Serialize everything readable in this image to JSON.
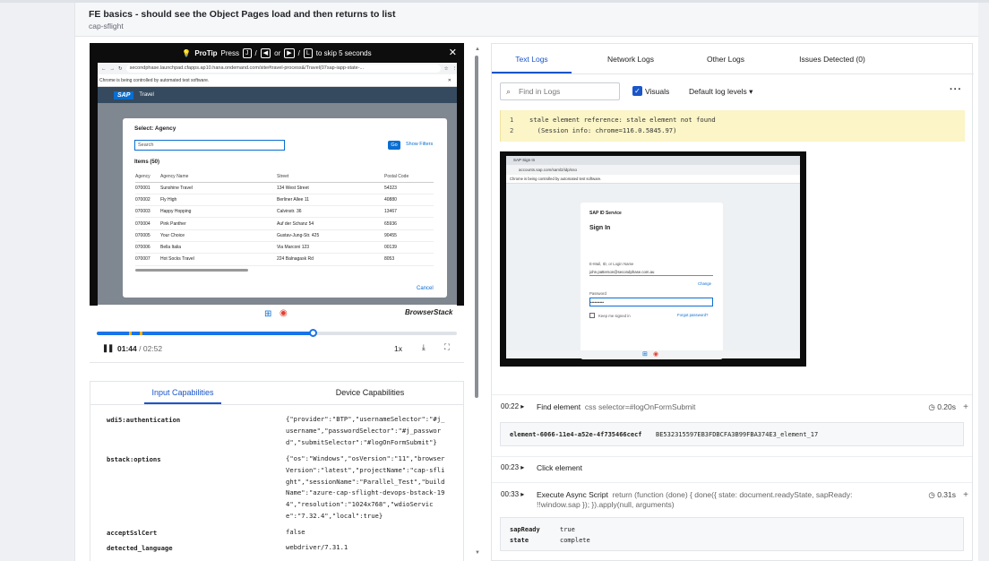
{
  "header": {
    "title": "FE basics - should see the Object Pages load and then returns to list",
    "subtitle": "cap-sflight"
  },
  "video": {
    "protip_label": "ProTip",
    "protip_press": "Press",
    "protip_keys": [
      "J",
      "K",
      "L"
    ],
    "protip_or": "or",
    "protip_slash": "/",
    "protip_suffix": "to skip 5 seconds",
    "browser_url": "secondphase.launchpad.cfapps.ap10.hana.ondemand.com/site#travel-process&/Travel(07sap-iapp-state-...",
    "automation_banner": "Chrome is being controlled by automated test software.",
    "sap_logo": "SAP",
    "app_title": "Travel",
    "dialog_title": "Select: Agency",
    "search_placeholder": "Search",
    "go_label": "Go",
    "show_filters": "Show Filters",
    "items_label": "Items (50)",
    "columns": [
      "Agency",
      "Agency Name",
      "Street",
      "Postal Code"
    ],
    "rows": [
      [
        "070001",
        "Sunshine Travel",
        "134 West Street",
        "54323"
      ],
      [
        "070002",
        "Fly High",
        "Berliner Allee 11",
        "40880"
      ],
      [
        "070003",
        "Happy Hopping",
        "Calvinstr. 36",
        "13467"
      ],
      [
        "070004",
        "Pink Panther",
        "Auf der Schanz 54",
        "65936"
      ],
      [
        "070005",
        "Your Choice",
        "Gustav-Jung-Str. 425",
        "90455"
      ],
      [
        "070006",
        "Bella Italia",
        "Via Marconi 123",
        "00139"
      ],
      [
        "070007",
        "Hot Socks Travel",
        "224 Balnagask Rd",
        "8053"
      ]
    ],
    "cancel_label": "Cancel",
    "brand": "BrowserStack",
    "current_time": "01:44",
    "duration": "02:52",
    "speed": "1x",
    "progress_fraction": 0.6,
    "marker_fractions": [
      0.09,
      0.12
    ]
  },
  "capabilities": {
    "tabs": [
      "Input Capabilities",
      "Device Capabilities"
    ],
    "rows": [
      {
        "key": "wdi5:authentication",
        "value": "{\"provider\":\"BTP\",\"usernameSelector\":\"#j_username\",\"passwordSelector\":\"#j_password\",\"submitSelector\":\"#logOnFormSubmit\"}"
      },
      {
        "key": "bstack:options",
        "value": "{\"os\":\"Windows\",\"osVersion\":\"11\",\"browserVersion\":\"latest\",\"projectName\":\"cap-sflight\",\"sessionName\":\"Parallel_Test\",\"buildName\":\"azure-cap-sflight-devops-bstack-194\",\"resolution\":\"1024x768\",\"wdioService\":\"7.32.4\",\"local\":true}"
      },
      {
        "key": "acceptSslCert",
        "value": "false"
      },
      {
        "key": "detected_language",
        "value": "webdriver/7.31.1"
      }
    ]
  },
  "logs": {
    "tabs": [
      "Text Logs",
      "Network Logs",
      "Other Logs",
      "Issues Detected (0)"
    ],
    "find_placeholder": "Find in Logs",
    "visuals_label": "Visuals",
    "levels_label": "Default log levels",
    "error_lines": [
      {
        "n": "1",
        "text": "stale element reference: stale element not found"
      },
      {
        "n": "2",
        "text": "  (Session info: chrome=116.0.5845.97)"
      }
    ],
    "screenshot": {
      "tab_label": "SAP Sign In",
      "url": "accounts.sap.com/saml2/idp/sso",
      "automation_banner": "Chrome is being controlled by automated test software.",
      "service": "SAP ID Service",
      "heading": "Sign In",
      "email_label": "E-Mail, ID, or Login Name",
      "email_value": "john.patterson@secondphase.com.au",
      "change_link": "Change",
      "password_label": "Password",
      "password_value": "••••••••••",
      "keep_signed": "Keep me signed in",
      "forgot": "Forgot password?"
    },
    "events": [
      {
        "time": "00:22",
        "name": "Find element",
        "detail": "css selector=#logOnFormSubmit",
        "duration": "0.20s",
        "code_key": "element-6066-11e4-a52e-4f735466cecf",
        "code_val": "BE532315597EB3FDBCFA3B99FBA374E3_element_17"
      },
      {
        "time": "00:23",
        "name": "Click element"
      },
      {
        "time": "00:33",
        "name": "Execute Async Script",
        "detail": "return (function (done) { done({ state: document.readyState, sapReady: !!window.sap }); }).apply(null, arguments)",
        "duration": "0.31s",
        "result": [
          {
            "k": "sapReady",
            "v": "true"
          },
          {
            "k": "state",
            "v": "complete"
          }
        ]
      }
    ]
  },
  "colors": {
    "accent": "#1a56c9",
    "error_bg": "#fbf5c7",
    "sap_shell": "#354a5f"
  }
}
